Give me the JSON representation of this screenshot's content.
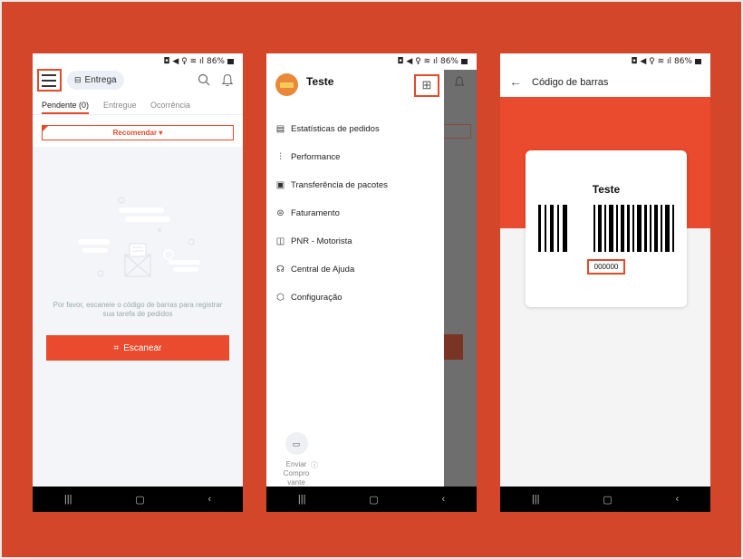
{
  "status_bar": {
    "battery": "86%"
  },
  "screen1": {
    "entrega_label": "Entrega",
    "tabs": [
      {
        "label": "Pendente (0)"
      },
      {
        "label": "Entregue"
      },
      {
        "label": "Ocorrência"
      }
    ],
    "recommend_label": "Recomendar ▾",
    "empty_message": "Por favor, escaneie o código de barras para registrar sua tarefa de pedidos",
    "scan_button": "Escanear"
  },
  "screen2": {
    "user_name": "Teste",
    "menu": [
      {
        "label": "Estatísticas de pedidos",
        "icon": "clipboard-icon"
      },
      {
        "label": "Performance",
        "icon": "chart-icon"
      },
      {
        "label": "Transferência de pacotes",
        "icon": "transfer-icon"
      },
      {
        "label": "Faturamento",
        "icon": "billing-icon"
      },
      {
        "label": "PNR - Motorista",
        "icon": "pnr-icon"
      },
      {
        "label": "Central de Ajuda",
        "icon": "headset-icon"
      },
      {
        "label": "Configuração",
        "icon": "settings-icon"
      }
    ],
    "enviar_label": "Enviar Compro vante"
  },
  "screen3": {
    "title": "Código de barras",
    "card_name": "Teste",
    "barcode_number": "000000"
  },
  "colors": {
    "accent": "#ea4a2d",
    "background": "#d4462a",
    "highlight": "#e34a2a"
  }
}
